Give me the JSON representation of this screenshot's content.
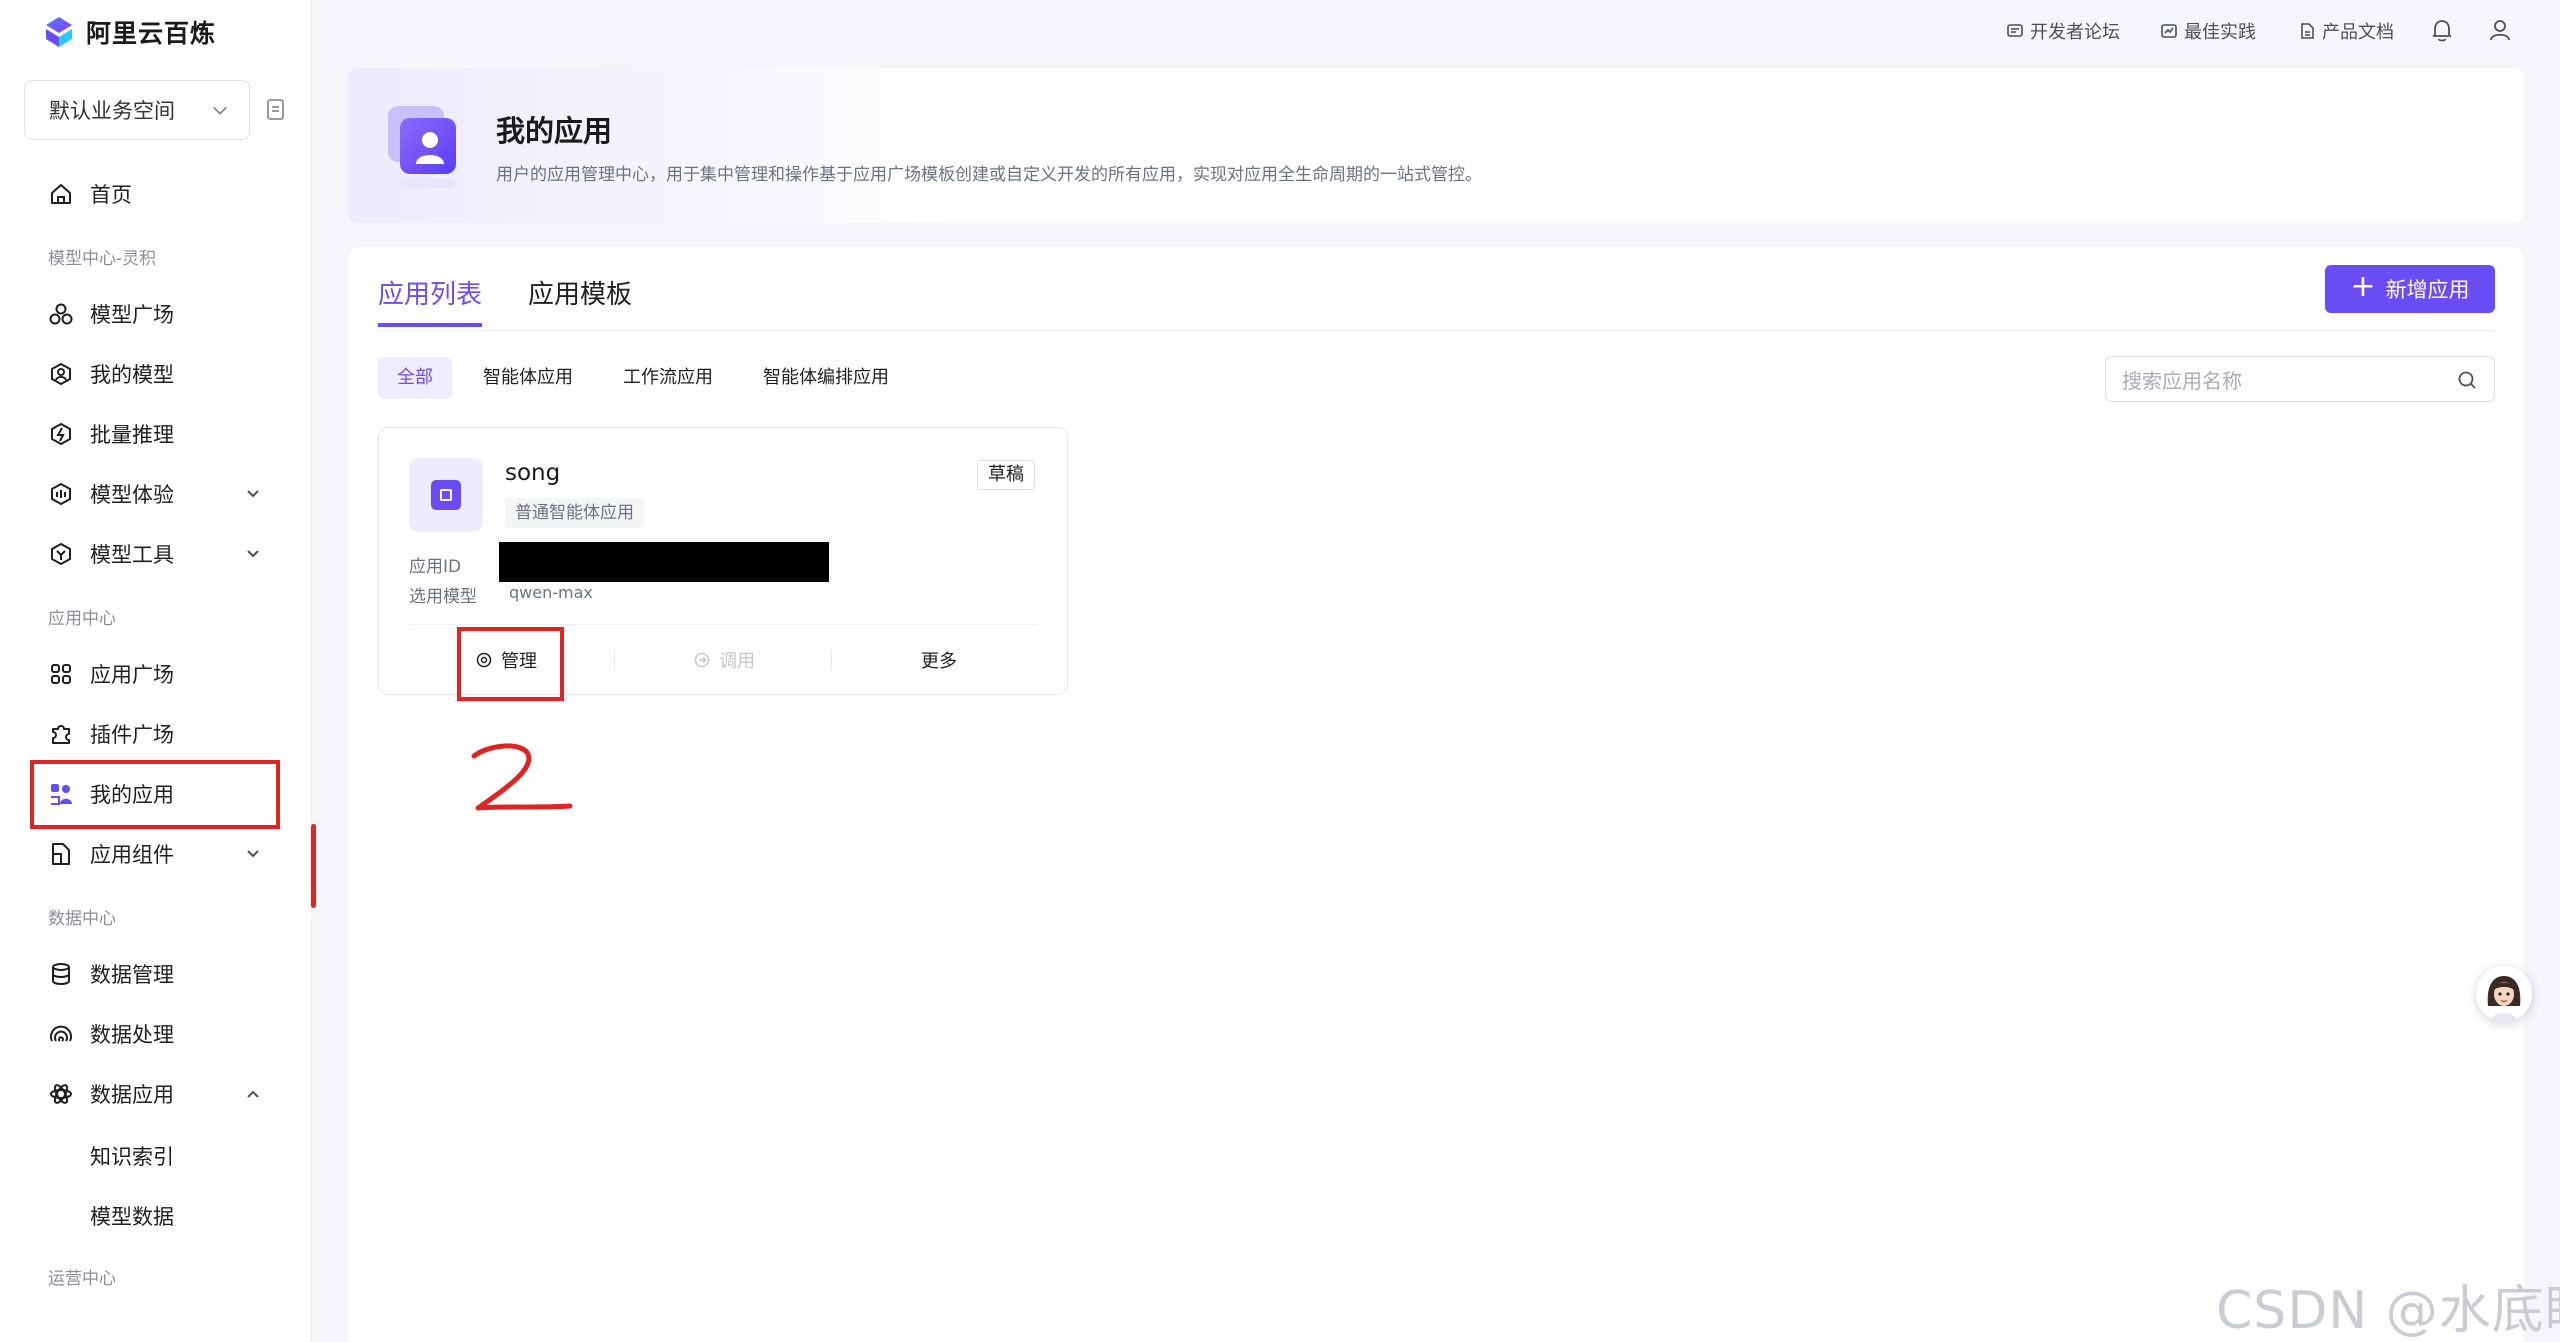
{
  "brand": {
    "name": "阿里云百炼"
  },
  "workspace": {
    "label": "默认业务空间"
  },
  "nav": {
    "home": "首页",
    "section_model": "模型中心-灵积",
    "model_square": "模型广场",
    "my_models": "我的模型",
    "batch_inference": "批量推理",
    "model_experience": "模型体验",
    "model_tools": "模型工具",
    "section_app": "应用中心",
    "app_square": "应用广场",
    "plugin_square": "插件广场",
    "my_apps": "我的应用",
    "app_components": "应用组件",
    "section_data": "数据中心",
    "data_management": "数据管理",
    "data_processing": "数据处理",
    "data_apps": "数据应用",
    "knowledge_index": "知识索引",
    "model_data": "模型数据",
    "section_ops": "运营中心"
  },
  "topbar": {
    "dev_forum": "开发者论坛",
    "best_practice": "最佳实践",
    "product_docs": "产品文档"
  },
  "header": {
    "title": "我的应用",
    "description": "用户的应用管理中心，用于集中管理和操作基于应用广场模板创建或自定义开发的所有应用，实现对应用全生命周期的一站式管控。"
  },
  "tabs": {
    "app_list": "应用列表",
    "app_templates": "应用模板"
  },
  "new_app_button": "新增应用",
  "filters": {
    "all": "全部",
    "agent": "智能体应用",
    "workflow": "工作流应用",
    "orchestration": "智能体编排应用"
  },
  "search": {
    "placeholder": "搜索应用名称"
  },
  "app_card": {
    "name": "song",
    "type": "普通智能体应用",
    "status": "草稿",
    "id_label": "应用ID",
    "model_label": "选用模型",
    "model_value": "qwen-max",
    "action_manage": "管理",
    "action_invoke": "调用",
    "action_more": "更多"
  },
  "watermark": "CSDN @水底眠",
  "colors": {
    "accent": "#6a4cf5",
    "annotation": "#e02424"
  }
}
